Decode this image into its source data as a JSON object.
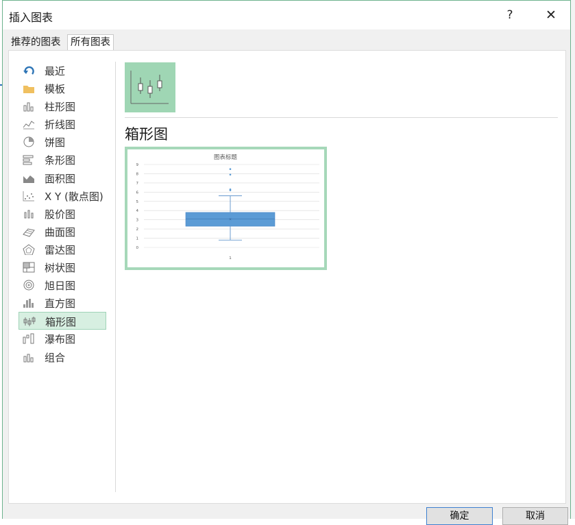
{
  "dialog": {
    "title": "插入图表",
    "help_label": "?",
    "close_label": "✕"
  },
  "tabs": [
    {
      "label": "推荐的图表",
      "active": false
    },
    {
      "label": "所有图表",
      "active": true
    }
  ],
  "sidebar": {
    "items": [
      {
        "label": "最近",
        "icon": "recent-icon"
      },
      {
        "label": "模板",
        "icon": "folder-icon"
      },
      {
        "label": "柱形图",
        "icon": "column-chart-icon"
      },
      {
        "label": "折线图",
        "icon": "line-chart-icon"
      },
      {
        "label": "饼图",
        "icon": "pie-chart-icon"
      },
      {
        "label": "条形图",
        "icon": "bar-chart-icon"
      },
      {
        "label": "面积图",
        "icon": "area-chart-icon"
      },
      {
        "label": "X Y (散点图)",
        "icon": "scatter-chart-icon"
      },
      {
        "label": "股价图",
        "icon": "stock-chart-icon"
      },
      {
        "label": "曲面图",
        "icon": "surface-chart-icon"
      },
      {
        "label": "雷达图",
        "icon": "radar-chart-icon"
      },
      {
        "label": "树状图",
        "icon": "treemap-chart-icon"
      },
      {
        "label": "旭日图",
        "icon": "sunburst-chart-icon"
      },
      {
        "label": "直方图",
        "icon": "histogram-chart-icon"
      },
      {
        "label": "箱形图",
        "icon": "box-whisker-chart-icon",
        "selected": true
      },
      {
        "label": "瀑布图",
        "icon": "waterfall-chart-icon"
      },
      {
        "label": "组合",
        "icon": "combo-chart-icon"
      }
    ]
  },
  "main": {
    "chart_type_heading": "箱形图"
  },
  "chart_data": {
    "type": "box",
    "title": "图表标题",
    "categories": [
      "1"
    ],
    "ylim": [
      0,
      9
    ],
    "y_ticks": [
      "0",
      "1",
      "2",
      "3",
      "4",
      "5",
      "6",
      "7",
      "8",
      "9"
    ],
    "box": {
      "whisker_low": 0.8,
      "q1": 2.3,
      "median": 3.1,
      "q3": 3.8,
      "whisker_high": 5.6,
      "mean": 3.1
    },
    "outliers": [
      6.2,
      6.3,
      7.9,
      8.5
    ],
    "colors": {
      "box": "#5b9bd5",
      "box_edge": "#4a86c5",
      "grid": "#d9d9d9"
    }
  },
  "footer": {
    "ok_label": "确定",
    "cancel_label": "取消"
  }
}
